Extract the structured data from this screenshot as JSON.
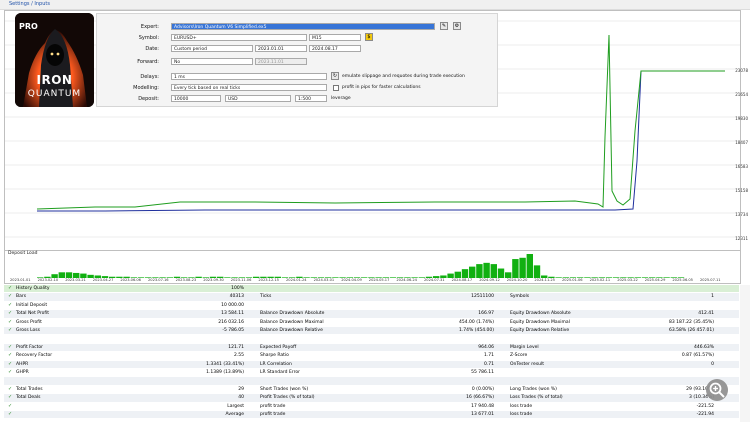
{
  "app": {
    "header_link": "Settings / Inputs",
    "chart_title": "Deposit Load"
  },
  "logo": {
    "badge": "PRO",
    "line1": "IRON",
    "line2": "QUANTUM",
    "colors": {
      "bg": "#111111",
      "fire": "#ff5a1f",
      "text": "#ffffff"
    }
  },
  "settings": {
    "expert_label": "Expert:",
    "expert_value": "Advisors\\Iron Quantum V6 Simplified.ex5",
    "symbol_label": "Symbol:",
    "symbol_value": "EURUSD+",
    "timeframe_value": "M15",
    "date_label": "Date:",
    "date_mode": "Custom period",
    "date_from": "2023.01.01",
    "date_to": "2024.08.17",
    "forward_label": "Forward:",
    "forward_value": "No",
    "forward_date": "2023.11.01",
    "delays_label": "Delays:",
    "delays_value": "1 ms",
    "delays_check": "emulate slippage and requotes during trade execution",
    "modelling_label": "Modelling:",
    "modelling_value": "Every tick based on real ticks",
    "modelling_check": "profit in pips for faster calculations",
    "deposit_label": "Deposit:",
    "deposit_value": "10000",
    "currency_value": "USD",
    "leverage_value": "1:500",
    "leverage_label": "leverage"
  },
  "right_scale": {
    "labels": [
      "23078",
      "21654",
      "19830",
      "18407",
      "16583",
      "15158",
      "13734",
      "12311"
    ]
  },
  "x_axis": {
    "labels": [
      "2023.01.01",
      "2023.02.10",
      "2023.03.21",
      "2023.04.27",
      "2023.06.06",
      "2023.07.16",
      "2023.08.23",
      "2023.09.30",
      "2023.11.06",
      "2023.12.15",
      "2024.01.24",
      "2024.03.01",
      "2024.04.09",
      "2024.05.17",
      "2024.06.24",
      "2024.07.31",
      "2024.08.17",
      "2024.09.12",
      "2024.10.20",
      "2024.11.25",
      "2025.01.06",
      "2025.02.11",
      "2025.03.22",
      "2025.04.29",
      "2025.06.05",
      "2025.07.11"
    ]
  },
  "results": {
    "rows": [
      {
        "c1": "History Quality",
        "v1": "100%",
        "c2": "",
        "v2": "",
        "c3": "",
        "v3": ""
      },
      {
        "c1": "Bars",
        "v1": "40313",
        "c2": "Ticks",
        "v2": "12511100",
        "c3": "Symbols",
        "v3": "1"
      },
      {
        "c1": "Initial Deposit",
        "v1": "10 000.00",
        "c2": "",
        "v2": "",
        "c3": "",
        "v3": ""
      },
      {
        "c1": "Total Net Profit",
        "v1": "13 584.11",
        "c2": "Balance Drawdown Absolute",
        "v2": "166.97",
        "c3": "Equity Drawdown Absolute",
        "v3": "412.41"
      },
      {
        "c1": "Gross Profit",
        "v1": "216 032.16",
        "c2": "Balance Drawdown Maximal",
        "v2": "454.00 (1.74%)",
        "c3": "Equity Drawdown Maximal",
        "v3": "83 187.22 (35.45%)"
      },
      {
        "c1": "Gross Loss",
        "v1": "-5 786.05",
        "c2": "Balance Drawdown Relative",
        "v2": "1.74% (454.00)",
        "c3": "Equity Drawdown Relative",
        "v3": "63.58% (26 457.01)"
      },
      {
        "c1": "",
        "v1": "",
        "c2": "",
        "v2": "",
        "c3": "",
        "v3": ""
      },
      {
        "c1": "Profit Factor",
        "v1": "121.71",
        "c2": "Expected Payoff",
        "v2": "964.06",
        "c3": "Margin Level",
        "v3": "446.63%"
      },
      {
        "c1": "Recovery Factor",
        "v1": "2.55",
        "c2": "Sharpe Ratio",
        "v2": "1.71",
        "c3": "Z-Score",
        "v3": "0.87 (61.57%)"
      },
      {
        "c1": "AHPR",
        "v1": "1.3341 (33.41%)",
        "c2": "LR Correlation",
        "v2": "0.71",
        "c3": "OnTester result",
        "v3": "0"
      },
      {
        "c1": "GHPR",
        "v1": "1.1389 (13.89%)",
        "c2": "LR Standard Error",
        "v2": "55 786.11",
        "c3": "",
        "v3": ""
      },
      {
        "c1": "",
        "v1": "",
        "c2": "",
        "v2": "",
        "c3": "",
        "v3": ""
      },
      {
        "c1": "Total Trades",
        "v1": "29",
        "c2": "Short Trades (won %)",
        "v2": "0 (0.00%)",
        "c3": "Long Trades (won %)",
        "v3": "29 (93.10%)"
      },
      {
        "c1": "Total Deals",
        "v1": "40",
        "c2": "Profit Trades (% of total)",
        "v2": "16 (66.67%)",
        "c3": "Loss Trades (% of total)",
        "v3": "3 (10.34%)"
      },
      {
        "c1": "",
        "v1": "Largest",
        "c2": "profit trade",
        "v2": "17 940.48",
        "c3": "loss trade",
        "v3": "-221.52"
      },
      {
        "c1": "",
        "v1": "Average",
        "c2": "profit trade",
        "v2": "13 677.01",
        "c3": "loss trade",
        "v3": "-221.94"
      }
    ]
  },
  "chart_data": {
    "type": "line",
    "series": [
      {
        "color": "#1f9d1f",
        "values": [
          1,
          1,
          1,
          1,
          1,
          1,
          1,
          1,
          1,
          1,
          1,
          1,
          1,
          1,
          1,
          1,
          1,
          1,
          1,
          1,
          1,
          1,
          1,
          1,
          1,
          1,
          1,
          1,
          1,
          1,
          1,
          1,
          1,
          1,
          1,
          1,
          1,
          1,
          1,
          1,
          1,
          1,
          1,
          1,
          1,
          1,
          1,
          1,
          1,
          1
        ]
      },
      {
        "color": "#1f2f9d",
        "values": [
          1,
          1,
          1,
          1,
          1,
          1,
          1,
          1,
          1,
          1,
          1,
          1,
          1,
          1,
          1,
          1,
          1,
          1,
          1,
          1,
          1,
          1,
          1,
          1,
          1,
          1,
          1,
          1,
          1,
          1,
          1,
          1,
          1,
          1,
          1,
          1,
          1,
          1,
          1,
          1,
          1,
          1,
          1,
          1,
          1,
          1,
          1,
          1,
          1,
          1
        ]
      }
    ],
    "deposit_load": [
      1,
      2,
      6,
      9,
      9,
      8,
      7,
      5,
      4,
      3,
      2,
      2,
      2,
      1,
      1,
      1,
      1,
      1,
      1,
      2,
      1,
      1,
      2,
      1,
      2,
      2,
      1,
      1,
      1,
      1,
      2,
      2,
      2,
      2,
      1,
      1,
      2,
      1,
      1,
      1,
      1,
      1,
      1,
      1,
      1,
      1,
      1,
      1,
      1,
      1,
      1,
      1,
      1,
      1,
      2,
      3,
      4,
      7,
      10,
      14,
      18,
      22,
      24,
      22,
      15,
      9,
      30,
      32,
      38,
      20,
      4,
      2,
      1,
      1,
      1,
      1,
      1,
      1,
      1,
      1,
      1,
      1,
      1,
      1,
      1,
      1,
      1,
      1,
      1,
      1
    ]
  }
}
